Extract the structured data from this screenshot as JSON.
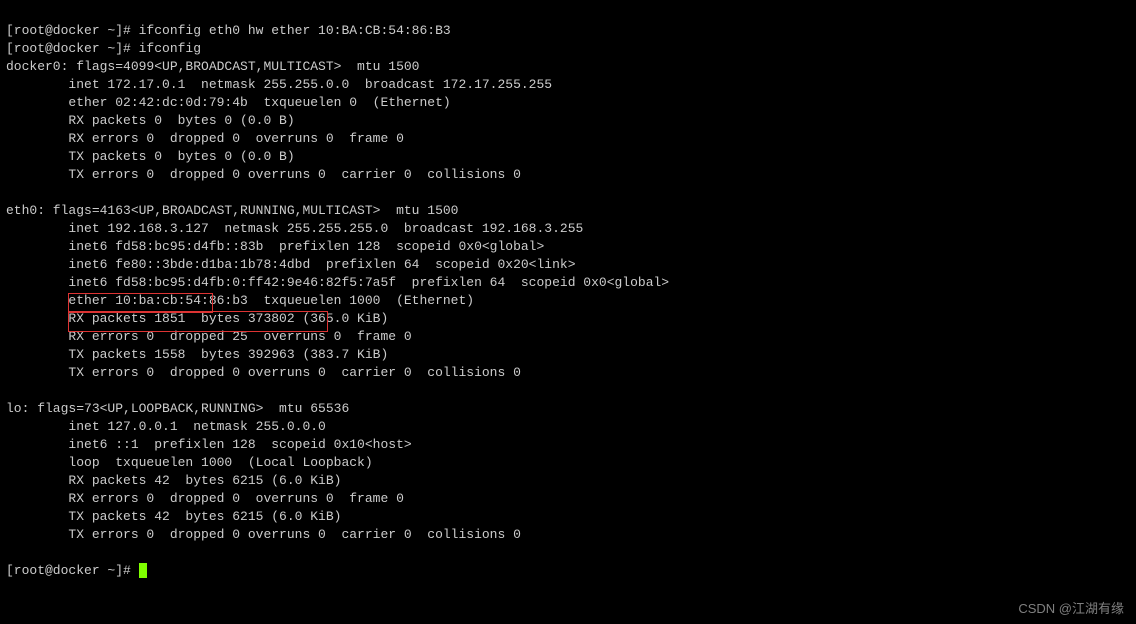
{
  "prompt1": "[root@docker ~]# ",
  "cmd1": "ifconfig eth0 hw ether 10:BA:CB:54:86:B3",
  "prompt2": "[root@docker ~]# ",
  "cmd2": "ifconfig",
  "docker0": {
    "header": "docker0: flags=4099<UP,BROADCAST,MULTICAST>  mtu 1500",
    "inet": "        inet 172.17.0.1  netmask 255.255.0.0  broadcast 172.17.255.255",
    "ether": "        ether 02:42:dc:0d:79:4b  txqueuelen 0  (Ethernet)",
    "rxp": "        RX packets 0  bytes 0 (0.0 B)",
    "rxe": "        RX errors 0  dropped 0  overruns 0  frame 0",
    "txp": "        TX packets 0  bytes 0 (0.0 B)",
    "txe": "        TX errors 0  dropped 0 overruns 0  carrier 0  collisions 0"
  },
  "eth0": {
    "header": "eth0: flags=4163<UP,BROADCAST,RUNNING,MULTICAST>  mtu 1500",
    "inet": "        inet 192.168.3.127  netmask 255.255.255.0  broadcast 192.168.3.255",
    "inet6a": "        inet6 fd58:bc95:d4fb::83b  prefixlen 128  scopeid 0x0<global>",
    "inet6b": "        inet6 fe80::3bde:d1ba:1b78:4dbd  prefixlen 64  scopeid 0x20<link>",
    "inet6cL": "        inet6 fd58:bc95:d4fb:0:f",
    "inet6cR": "f42:9e46:82f5:7a5f  prefixlen 64  scopeid 0x0<global>",
    "etherL": "        ether 10:ba:cb:54:86:b3 ",
    "etherR": " txqueuelen 1000  (Ethernet)",
    "rxp": "        RX packets 1851  bytes 373802 (365.0 KiB)",
    "rxe": "        RX errors 0  dropped 25  overruns 0  frame 0",
    "txp": "        TX packets 1558  bytes 392963 (383.7 KiB)",
    "txe": "        TX errors 0  dropped 0 overruns 0  carrier 0  collisions 0"
  },
  "lo": {
    "header": "lo: flags=73<UP,LOOPBACK,RUNNING>  mtu 65536",
    "inet": "        inet 127.0.0.1  netmask 255.0.0.0",
    "inet6": "        inet6 ::1  prefixlen 128  scopeid 0x10<host>",
    "loop": "        loop  txqueuelen 1000  (Local Loopback)",
    "rxp": "        RX packets 42  bytes 6215 (6.0 KiB)",
    "rxe": "        RX errors 0  dropped 0  overruns 0  frame 0",
    "txp": "        TX packets 42  bytes 6215 (6.0 KiB)",
    "txe": "        TX errors 0  dropped 0 overruns 0  carrier 0  collisions 0"
  },
  "prompt3": "[root@docker ~]# ",
  "watermark": "CSDN @江湖有缘"
}
